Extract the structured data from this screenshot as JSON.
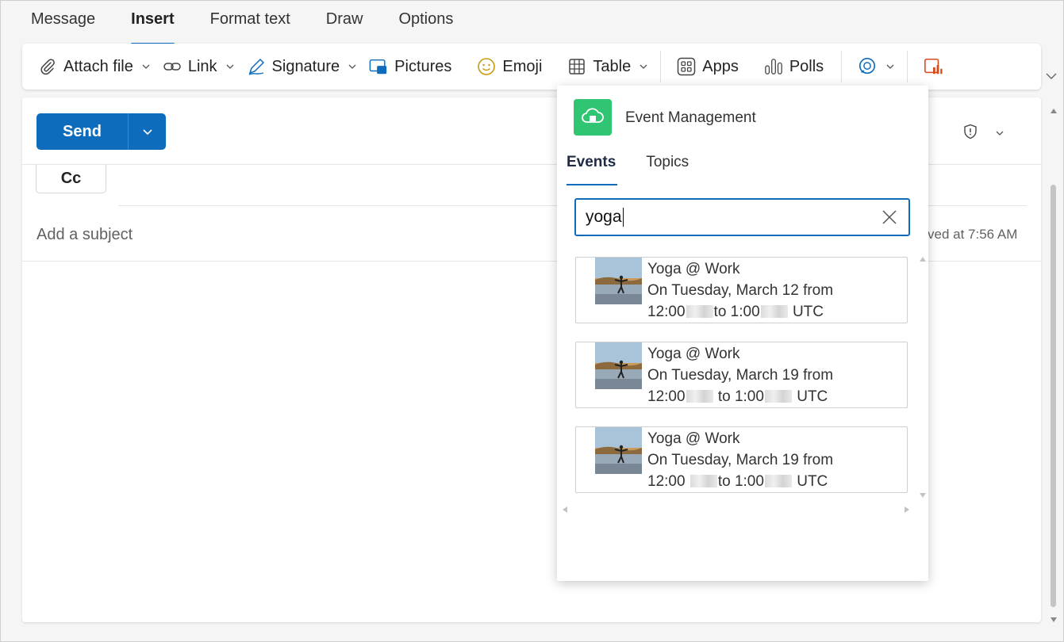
{
  "tabs": [
    {
      "label": "Message"
    },
    {
      "label": "Insert"
    },
    {
      "label": "Format text"
    },
    {
      "label": "Draw"
    },
    {
      "label": "Options"
    }
  ],
  "ribbon": {
    "attach": "Attach file",
    "link": "Link",
    "signature": "Signature",
    "pictures": "Pictures",
    "emoji": "Emoji",
    "table": "Table",
    "apps": "Apps",
    "polls": "Polls"
  },
  "compose": {
    "send": "Send",
    "cc": "Cc",
    "subject_placeholder": "Add a subject",
    "saved": "ved at 7:56 AM"
  },
  "panel": {
    "title": "Event Management",
    "tabs": [
      {
        "label": "Events"
      },
      {
        "label": "Topics"
      }
    ],
    "search_value": "yoga",
    "results": [
      {
        "title": "Yoga @ Work",
        "date": "On Tuesday, March 12  from",
        "start": "12:00",
        "to": "to 1:00",
        "tz": "UTC"
      },
      {
        "title": "Yoga @ Work",
        "date": "On Tuesday, March 19  from",
        "start": "12:00",
        "to": "to 1:00",
        "tz": "UTC"
      },
      {
        "title": "Yoga @ Work",
        "date": "On Tuesday, March 19  from",
        "start": "12:00",
        "to": "to 1:00",
        "tz": "UTC"
      }
    ]
  },
  "colors": {
    "accent": "#0f6cbd",
    "app_icon": "#2fc573"
  }
}
